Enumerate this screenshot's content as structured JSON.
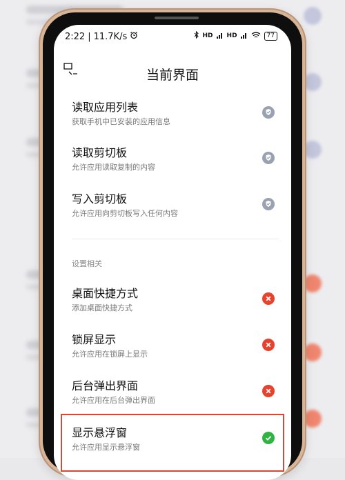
{
  "status_bar": {
    "time": "2:22",
    "speed": "11.7K/s",
    "alarm_icon": "alarm-clock-icon",
    "bluetooth_icon": "bluetooth-icon",
    "signal1": "HD",
    "signal2": "HD",
    "wifi_icon": "wifi-icon",
    "battery": "77"
  },
  "header": {
    "title": "当前界面",
    "back_icon": "back-window-icon"
  },
  "items": [
    {
      "name": "读取应用列表",
      "desc": "获取手机中已安装的应用信息",
      "state": "shield",
      "color": "#9aa2b1"
    },
    {
      "name": "读取剪切板",
      "desc": "允许应用读取复制的内容",
      "state": "shield",
      "color": "#9aa2b1"
    },
    {
      "name": "写入剪切板",
      "desc": "允许应用向剪切板写入任何内容",
      "state": "shield",
      "color": "#9aa2b1"
    }
  ],
  "section": {
    "label": "设置相关"
  },
  "settings": [
    {
      "name": "桌面快捷方式",
      "desc": "添加桌面快捷方式",
      "state": "denied",
      "color": "#e8412c"
    },
    {
      "name": "锁屏显示",
      "desc": "允许应用在锁屏上显示",
      "state": "denied",
      "color": "#e8412c"
    },
    {
      "name": "后台弹出界面",
      "desc": "允许应用在后台弹出界面",
      "state": "denied",
      "color": "#e8412c"
    },
    {
      "name": "显示悬浮窗",
      "desc": "允许应用显示悬浮窗",
      "state": "allowed",
      "color": "#2fb341"
    }
  ]
}
